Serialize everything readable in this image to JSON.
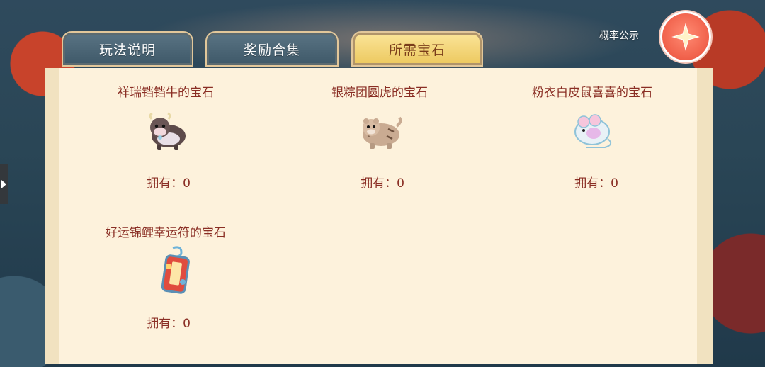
{
  "tabs": [
    {
      "label": "玩法说明",
      "active": false
    },
    {
      "label": "奖励合集",
      "active": false
    },
    {
      "label": "所需宝石",
      "active": true
    }
  ],
  "probability_label": "概率公示",
  "close_icon": "close-star-icon",
  "gems": [
    {
      "title": "祥瑞铛铛牛的宝石",
      "owned": "拥有：0",
      "icon": "ox-icon"
    },
    {
      "title": "银粽团圆虎的宝石",
      "owned": "拥有：0",
      "icon": "tiger-icon"
    },
    {
      "title": "粉衣白皮鼠喜喜的宝石",
      "owned": "拥有：0",
      "icon": "mouse-icon"
    },
    {
      "title": "好运锦鲤幸运符的宝石",
      "owned": "拥有：0",
      "icon": "charm-icon"
    }
  ],
  "colors": {
    "panel": "#fdf2dc",
    "text": "#8a2e24",
    "tab_active": "#f2d370",
    "tab_inactive": "#4a6474"
  }
}
